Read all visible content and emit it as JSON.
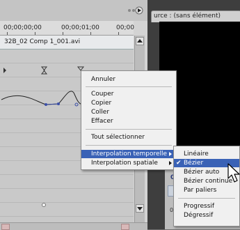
{
  "timeline": {
    "timecode_start": "00;00;00;00",
    "timecode_mid": "00;00;01;00",
    "timecode_end": "00;00",
    "clip_name": "32B_02 Comp 1_001.avi"
  },
  "monitor": {
    "tab_label": "urce : (sans élément)",
    "lower_timecode": "00;",
    "lower_small": "00;00;"
  },
  "context_menu": {
    "items": [
      {
        "label": "Annuler"
      },
      {
        "label": "Couper"
      },
      {
        "label": "Copier"
      },
      {
        "label": "Coller"
      },
      {
        "label": "Effacer"
      },
      {
        "label": "Tout sélectionner"
      },
      {
        "label": "Interpolation temporelle",
        "submenu": true,
        "highlighted": true
      },
      {
        "label": "Interpolation spatiale",
        "submenu": true
      }
    ]
  },
  "submenu": {
    "items": [
      {
        "label": "Linéaire"
      },
      {
        "label": "Bézier",
        "checked": true,
        "highlighted": true
      },
      {
        "label": "Bézier auto"
      },
      {
        "label": "Bézier continue"
      },
      {
        "label": "Par paliers"
      },
      {
        "label": "Progressif"
      },
      {
        "label": "Dégressif"
      }
    ]
  },
  "icons": {
    "checkmark": "checkmark-icon",
    "cursor": "arrow-cursor-icon",
    "keyframe": "keyframe-icon"
  },
  "colors": {
    "highlight": "#3a62b6",
    "menu_bg": "#f0f0f0",
    "panel_bg": "#d3d3d3",
    "monitor_bg": "#000000"
  }
}
